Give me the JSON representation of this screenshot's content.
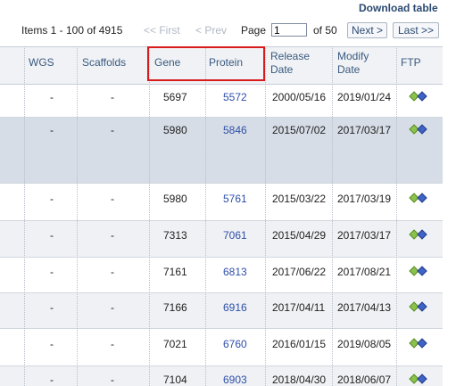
{
  "download_label": "Download table",
  "pager": {
    "items_text": "Items 1 - 100 of 4915",
    "first": "<< First",
    "prev": "< Prev",
    "page_label": "Page",
    "page_value": "1",
    "of_text": "of 50",
    "next": "Next >",
    "last": "Last >>"
  },
  "columns": {
    "wgs": "WGS",
    "scaffolds": "Scaffolds",
    "gene": "Gene",
    "protein": "Protein",
    "release": "Release Date",
    "modify": "Modify Date",
    "ftp": "FTP"
  },
  "rows": [
    {
      "wgs": "-",
      "scaffolds": "-",
      "gene": "5697",
      "protein": "5572",
      "release": "2000/05/16",
      "modify": "2019/01/24"
    },
    {
      "wgs": "-",
      "scaffolds": "-",
      "gene": "5980",
      "protein": "5846",
      "release": "2015/07/02",
      "modify": "2017/03/17"
    },
    {
      "wgs": "-",
      "scaffolds": "-",
      "gene": "5980",
      "protein": "5761",
      "release": "2015/03/22",
      "modify": "2017/03/19"
    },
    {
      "wgs": "-",
      "scaffolds": "-",
      "gene": "7313",
      "protein": "7061",
      "release": "2015/04/29",
      "modify": "2017/03/17"
    },
    {
      "wgs": "-",
      "scaffolds": "-",
      "gene": "7161",
      "protein": "6813",
      "release": "2017/06/22",
      "modify": "2017/08/21"
    },
    {
      "wgs": "-",
      "scaffolds": "-",
      "gene": "7166",
      "protein": "6916",
      "release": "2017/04/11",
      "modify": "2017/04/13"
    },
    {
      "wgs": "-",
      "scaffolds": "-",
      "gene": "7021",
      "protein": "6760",
      "release": "2016/01/15",
      "modify": "2019/08/05"
    },
    {
      "wgs": "-",
      "scaffolds": "-",
      "gene": "7104",
      "protein": "6903",
      "release": "2018/04/30",
      "modify": "2018/06/07"
    }
  ],
  "colors": {
    "highlight": "#d81c1c",
    "link": "#2e4fa8",
    "ftp_green": "#8bc34a",
    "ftp_blue": "#3f63c6"
  }
}
